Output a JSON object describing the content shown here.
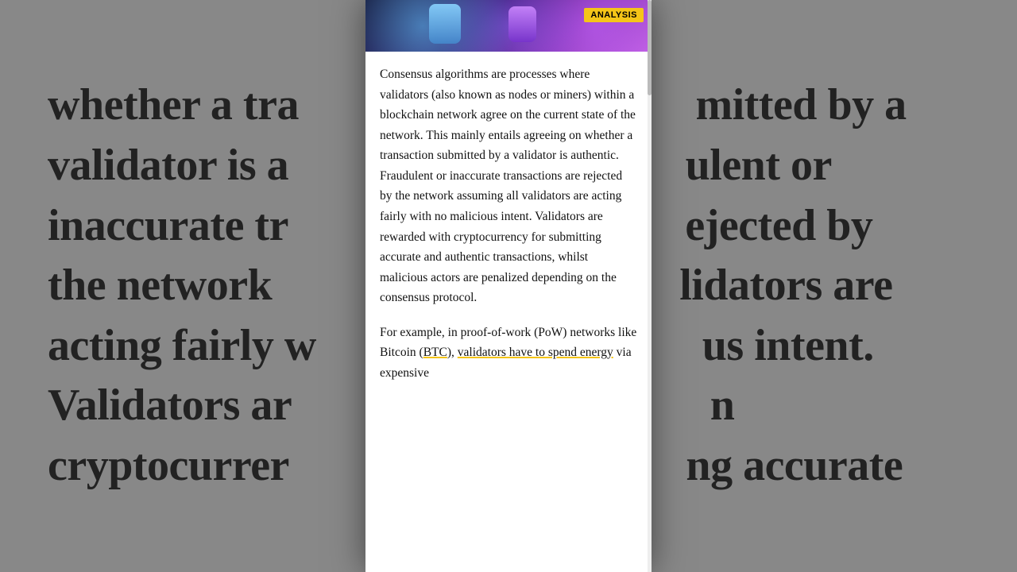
{
  "background": {
    "text_lines": [
      "whether a tra",
      "validator is a",
      "inaccurate tr",
      "the network",
      "acting fairly w",
      "Validators ar",
      "cryptocurrer"
    ],
    "right_text_lines": [
      "mitted by a",
      "ulent or",
      "ejected by",
      "lidators are",
      "us intent.",
      "n",
      "ng accurate"
    ]
  },
  "modal": {
    "badge": "ANALYSIS",
    "paragraph1": "Consensus algorithms are processes where validators (also known as nodes or miners) within a blockchain network agree on the current state of the network. This mainly entails agreeing on whether a transaction submitted by a validator is authentic. Fraudulent or inaccurate transactions are rejected by the network assuming all validators are acting fairly with no malicious intent. Validators are rewarded with cryptocurrency for submitting accurate and authentic transactions, whilst malicious actors are penalized depending on the consensus protocol.",
    "paragraph2_prefix": "For example, in proof-of-work (PoW) networks like Bitcoin (",
    "btc_link": "BTC",
    "paragraph2_middle": "), ",
    "validators_link": "validators have to spend energy",
    "paragraph2_suffix": " via expensive"
  }
}
